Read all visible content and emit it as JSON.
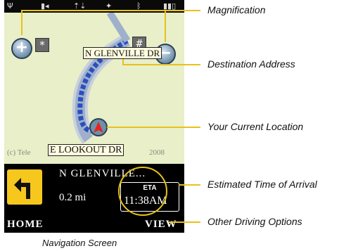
{
  "status_bar": {
    "icons": [
      "signal-icon",
      "data-icon",
      "data-transfer-icon",
      "gps-icon",
      "bluetooth-icon",
      "battery-icon"
    ],
    "glyphs": {
      "signal": "Ψ",
      "data": "▮◂",
      "transfer": "⇡⇣",
      "gps": "✦",
      "bluetooth": "ᛒ",
      "battery": "▮▮▯"
    }
  },
  "map": {
    "zoom_in_glyph": "+",
    "zoom_out_glyph": "−",
    "star_key": "*",
    "hash_key": "#",
    "destination_street": "N GLENVILLE DR",
    "current_street": "E LOOKOUT DR",
    "copyright_prefix": "(c) Tele",
    "copyright_year": "2008",
    "colors": {
      "background": "#e8efc9",
      "route": "#2a4fbf",
      "road": "#b8c4d6"
    }
  },
  "navigation": {
    "next_street": "N GLENVILLE...",
    "distance": "0.2 mi",
    "eta_label": "ETA",
    "eta_time": "11:38AM",
    "turn_icon": "turn-left-icon",
    "turn_color": "#f6c71c"
  },
  "softkeys": {
    "left": "HOME",
    "right": "VIEW"
  },
  "callouts": {
    "magnification": "Magnification",
    "destination_address": "Destination Address",
    "current_location": "Your Current Location",
    "eta": "Estimated Time of Arrival",
    "driving_options": "Other Driving Options"
  },
  "caption": "Navigation Screen"
}
